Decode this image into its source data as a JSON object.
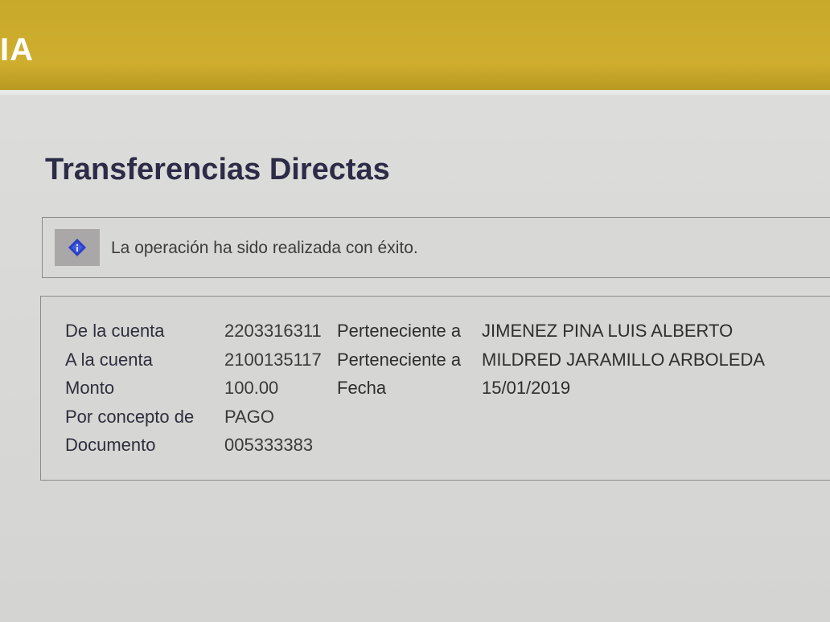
{
  "header": {
    "brand_fragment": "IA"
  },
  "page": {
    "title": "Transferencias Directas"
  },
  "message": {
    "icon": "info-diamond-icon",
    "text": "La operación ha sido realizada con éxito."
  },
  "details": {
    "from_account": {
      "label": "De la cuenta",
      "number": "2203316311",
      "owner_label": "Perteneciente a",
      "owner": "JIMENEZ PINA LUIS ALBERTO"
    },
    "to_account": {
      "label": "A la cuenta",
      "number": "2100135117",
      "owner_label": "Perteneciente a",
      "owner": "MILDRED JARAMILLO ARBOLEDA"
    },
    "amount": {
      "label": "Monto",
      "value": "100.00",
      "date_label": "Fecha",
      "date": "15/01/2019"
    },
    "concept": {
      "label": "Por concepto de",
      "value": "PAGO"
    },
    "document": {
      "label": "Documento",
      "value": "005333383"
    }
  },
  "colors": {
    "banner": "#cfae2e",
    "title": "#2c2c48",
    "icon_blue": "#2b3fc4"
  }
}
